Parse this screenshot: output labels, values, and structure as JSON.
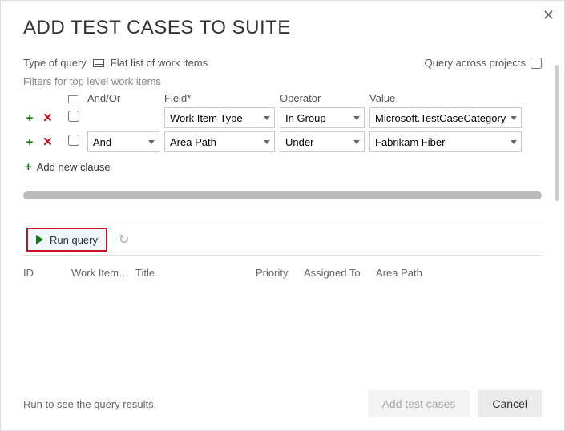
{
  "title": "ADD TEST CASES TO SUITE",
  "close_tooltip": "Close",
  "queryTypeLabel": "Type of query",
  "queryTypeValue": "Flat list of work items",
  "queryAcrossLabel": "Query across projects",
  "filtersLabel": "Filters for top level work items",
  "headers": {
    "andor": "And/Or",
    "field": "Field*",
    "operator": "Operator",
    "value": "Value"
  },
  "rows": [
    {
      "andor": "",
      "field": "Work Item Type",
      "operator": "In Group",
      "value": "Microsoft.TestCaseCategory"
    },
    {
      "andor": "And",
      "field": "Area Path",
      "operator": "Under",
      "value": "Fabrikam Fiber"
    }
  ],
  "addClause": "Add new clause",
  "runQuery": "Run query",
  "columns": {
    "id": "ID",
    "wit": "Work Item…",
    "title": "Title",
    "priority": "Priority",
    "assigned": "Assigned To",
    "area": "Area Path"
  },
  "footer": {
    "message": "Run to see the query results.",
    "add": "Add test cases",
    "cancel": "Cancel"
  }
}
